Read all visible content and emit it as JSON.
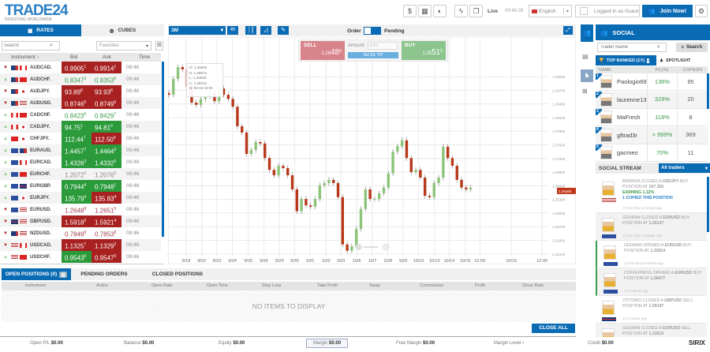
{
  "header": {
    "logo": "TRADE24",
    "logo_sub": "INVESTING WORLDWIDE",
    "live": "Live",
    "clock": "09:46:38",
    "language": "English",
    "login_status": "Logged in as Guest",
    "join_label": "Join Now!"
  },
  "rates": {
    "tabs": [
      "RATES",
      "CUBES"
    ],
    "search_placeholder": "Search",
    "filter": "Favorites",
    "columns": [
      "Instrument ↑",
      "Bid",
      "Ask",
      "Time"
    ],
    "rows": [
      {
        "name": "AUDCAD.",
        "dir": "down",
        "bid": "0.9905",
        "bid_sup": "1",
        "bid_state": "red",
        "ask": "0.9914",
        "ask_sup": "1",
        "ask_state": "red",
        "time": "09:46"
      },
      {
        "name": "AUDCHF.",
        "dir": "up",
        "bid": "0.8347",
        "bid_sup": "3",
        "bid_state": "up",
        "ask": "0.8353",
        "ask_sup": "6",
        "ask_state": "up",
        "time": "09:46"
      },
      {
        "name": "AUDJPY.",
        "dir": "down",
        "bid": "93.89",
        "bid_sup": "8",
        "bid_state": "red",
        "ask": "93.93",
        "ask_sup": "8",
        "ask_state": "red",
        "time": "09:46"
      },
      {
        "name": "AUDUSD.",
        "dir": "down",
        "bid": "0.8746",
        "bid_sup": "0",
        "bid_state": "red",
        "ask": "0.8749",
        "ask_sup": "6",
        "ask_state": "red",
        "time": "09:46"
      },
      {
        "name": "CADCHF.",
        "dir": "up",
        "bid": "0.8423",
        "bid_sup": "6",
        "bid_state": "up",
        "ask": "0.8429",
        "ask_sup": "7",
        "ask_state": "up",
        "time": "09:46"
      },
      {
        "name": "CADJPY.",
        "dir": "up",
        "bid": "94.75",
        "bid_sup": "1",
        "bid_state": "green",
        "ask": "94.81",
        "ask_sup": "0",
        "ask_state": "green",
        "time": "09:46"
      },
      {
        "name": "CHFJPY.",
        "dir": "up",
        "bid": "112.44",
        "bid_sup": "7",
        "bid_state": "green",
        "ask": "112.50",
        "ask_sup": "9",
        "ask_state": "red",
        "time": "09:46"
      },
      {
        "name": "EURAUD.",
        "dir": "up",
        "bid": "1.4457",
        "bid_sup": "7",
        "bid_state": "green",
        "ask": "1.4464",
        "ask_sup": "3",
        "ask_state": "green",
        "time": "09:46"
      },
      {
        "name": "EURCAD.",
        "dir": "up",
        "bid": "1.4326",
        "bid_sup": "3",
        "bid_state": "green",
        "ask": "1.4332",
        "ask_sup": "5",
        "ask_state": "green",
        "time": "09:46"
      },
      {
        "name": "EURCHF.",
        "dir": "up",
        "bid": "1.2072",
        "bid_sup": "6",
        "bid_state": "none",
        "ask": "1.2076",
        "ask_sup": "9",
        "ask_state": "none",
        "time": "09:46"
      },
      {
        "name": "EURGBP.",
        "dir": "up",
        "bid": "0.7944",
        "bid_sup": "4",
        "bid_state": "green",
        "ask": "0.7948",
        "ask_sup": "1",
        "ask_state": "green",
        "time": "09:46"
      },
      {
        "name": "EURJPY.",
        "dir": "up",
        "bid": "135.79",
        "bid_sup": "4",
        "bid_state": "green",
        "ask": "135.83",
        "ask_sup": "4",
        "ask_state": "red",
        "time": "09:46"
      },
      {
        "name": "EURUSD.",
        "dir": "down",
        "bid": "1.2648",
        "bid_sup": "8",
        "bid_state": "down",
        "ask": "1.2651",
        "ask_sup": "5",
        "ask_state": "down",
        "time": "09:46"
      },
      {
        "name": "GBPUSD.",
        "dir": "down",
        "bid": "1.5918",
        "bid_sup": "0",
        "bid_state": "red",
        "ask": "1.5921",
        "ask_sup": "4",
        "ask_state": "red",
        "time": "09:46"
      },
      {
        "name": "NZDUSD.",
        "dir": "down",
        "bid": "0.7849",
        "bid_sup": "8",
        "bid_state": "down",
        "ask": "0.7853",
        "ask_sup": "8",
        "ask_state": "down",
        "time": "09:46"
      },
      {
        "name": "USDCAD.",
        "dir": "down",
        "bid": "1.1325",
        "bid_sup": "7",
        "bid_state": "red",
        "ask": "1.1329",
        "ask_sup": "2",
        "ask_state": "red",
        "time": "09:46"
      },
      {
        "name": "USDCHF.",
        "dir": "up",
        "bid": "0.9543",
        "bid_sup": "5",
        "bid_state": "green",
        "ask": "0.9547",
        "ask_sup": "0",
        "ask_state": "red",
        "time": "09:46"
      }
    ]
  },
  "chart_toolbar": {
    "period": "3M",
    "interval": "4h",
    "order_label": "Order",
    "pending_label": "Pending"
  },
  "trade_box": {
    "sell_label": "SELL",
    "sell_price": "1.26",
    "sell_big": "48",
    "sell_sup": "6",
    "amount_label": "Amount",
    "amount_value": "0.01",
    "sl_tp_label": "Set S/L T/P",
    "buy_label": "BUY",
    "buy_price": "1.26",
    "buy_big": "51",
    "buy_sup": "6"
  },
  "tooltip": {
    "o_label": "O:",
    "o": "1.28836",
    "h_label": "H:",
    "h": "1.28873",
    "l_label": "L:",
    "l": "1.28828",
    "c_label": "C:",
    "c": "1.28215",
    "d_label": "D:",
    "d": "09-18 16:00"
  },
  "colors": {
    "brand": "#0a6bb5",
    "up": "#2a9a3a",
    "down": "#a82020",
    "candle_up": "#8cc47a",
    "candle_down": "#b8381a"
  },
  "chart_data": {
    "type": "candlestick",
    "current_price": "1.26486",
    "ylim": [
      1.2487,
      1.2987
    ],
    "xlim": [
      -0.17,
      89.0
    ],
    "yticks": [
      "1.29000",
      "1.28700",
      "1.28400",
      "1.28100",
      "1.27800",
      "1.27500",
      "1.27200",
      "1.26900",
      "1.26600",
      "1.26300",
      "1.26000",
      "1.25700",
      "1.25400",
      "1.25100"
    ],
    "xticks": [
      {
        "label": "9/19",
        "i": 3.8
      },
      {
        "label": "9/22",
        "i": 7.2
      },
      {
        "label": "9/23",
        "i": 10.5
      },
      {
        "label": "9/24",
        "i": 13.9
      },
      {
        "label": "9/25",
        "i": 17.4
      },
      {
        "label": "9/26",
        "i": 20.8
      },
      {
        "label": "9/29",
        "i": 24.2
      },
      {
        "label": "9/30",
        "i": 27.5
      },
      {
        "label": "10/1",
        "i": 30.9
      },
      {
        "label": "10/2",
        "i": 34.4
      },
      {
        "label": "10/3",
        "i": 37.6
      },
      {
        "label": "10/6",
        "i": 41.1
      },
      {
        "label": "10/7",
        "i": 44.5
      },
      {
        "label": "10/8",
        "i": 47.9
      },
      {
        "label": "10/9",
        "i": 51.2
      },
      {
        "label": "10/10",
        "i": 54.6
      },
      {
        "label": "10/13",
        "i": 58.1
      },
      {
        "label": "10/14",
        "i": 61.3
      },
      {
        "label": "10/15",
        "i": 64.8
      },
      {
        "label": "12:00",
        "i": 68.0
      },
      {
        "label": "10/16",
        "i": 74.9
      },
      {
        "label": "12:00",
        "i": 81.6
      }
    ],
    "close": [
      1.286,
      1.2895,
      1.2921,
      1.2916,
      1.2878,
      1.2843,
      1.2838,
      1.2851,
      1.2857,
      1.2864,
      1.2846,
      1.2874,
      1.286,
      1.2851,
      1.2834,
      1.2791,
      1.2777,
      1.273,
      1.2739,
      1.2756,
      1.2753,
      1.2721,
      1.2695,
      1.2683,
      1.2704,
      1.2699,
      1.2683,
      1.2652,
      1.2604,
      1.2631,
      1.2617,
      1.2614,
      1.2631,
      1.2661,
      1.2666,
      1.2673,
      1.2666,
      1.2635,
      1.2531,
      1.2517,
      1.2527,
      1.2565,
      1.2609,
      1.2652,
      1.2631,
      1.2631,
      1.2643,
      1.2656,
      1.2687,
      1.2735,
      1.2747,
      1.276,
      1.2721,
      1.269,
      1.2695,
      1.2678,
      1.2638,
      1.2635,
      1.2666,
      1.2678,
      1.2746,
      1.2721,
      1.2704,
      1.2673,
      1.2656,
      1.2652,
      1.2656
    ]
  },
  "social": {
    "title": "SOCIAL",
    "search_placeholder": "Trader Name",
    "search_label": "Search",
    "tabs": [
      "TOP RANKED (1Y)",
      "SPOTLIGHT"
    ],
    "columns": [
      "NAME",
      "P/L(%)",
      "COPIERS"
    ],
    "traders": [
      {
        "rank": "1",
        "name": "Paologio69",
        "pl": "136%",
        "copiers": "95"
      },
      {
        "rank": "2",
        "name": "laurenne13",
        "pl": "329%",
        "copiers": "20"
      },
      {
        "rank": "3",
        "name": "MaFresh",
        "pl": "118%",
        "copiers": "8"
      },
      {
        "rank": "4",
        "name": "gftrad3r",
        "pl": "> 999%",
        "copiers": "369"
      },
      {
        "rank": "5",
        "name": "gacmeo",
        "pl": "70%",
        "copiers": "11"
      }
    ],
    "stream_title": "SOCIAL STREAM",
    "stream_filter": "All traders",
    "stream": [
      {
        "who": "BRIANZA",
        "action": "CLOSED A",
        "sym": "USDJPY",
        "side": "BUY",
        "at": "POSITION AT",
        "price": "107.350",
        "extra1": "EARNING 1.12%",
        "extra2": "1 COPIED THIS POSITION",
        "ago": "less than a minute ago"
      },
      {
        "who": "GDURAN",
        "action": "CLOSED A",
        "sym": "EURUSD",
        "side": "BUY",
        "at": "POSITION AT",
        "price": "1.20137",
        "ago": "less than a minute ago"
      },
      {
        "who": "GDURAN",
        "action": "OPENED A",
        "sym": "EURUSD",
        "side": "BUY",
        "at": "POSITION AT",
        "price": "1.32814",
        "ago": "less than a minute ago"
      },
      {
        "who": "COFFEPRESS",
        "action": "OPENED A",
        "sym": "EURUSD",
        "side": "BUY",
        "at": "POSITION AT",
        "price": "1.26477",
        "ago": "1 minute ago"
      },
      {
        "who": "VITTORIO",
        "action": "CLOSED A",
        "sym": "GBPUSD",
        "side": "SELL",
        "at": "POSITION AT",
        "price": "1.59197",
        "ago": "1 minute ago"
      },
      {
        "who": "GDURAN",
        "action": "CLOSED A",
        "sym": "EURUSD",
        "side": "SELL",
        "at": "POSITION AT",
        "price": "1.32813",
        "ago": ""
      }
    ]
  },
  "positions": {
    "tabs": [
      "OPEN POSITIONS (0)",
      "PENDING ORDERS",
      "CLOSED POSITIONS"
    ],
    "columns": [
      "Instrument",
      "Action",
      "Open Rate",
      "Open Time",
      "Stop Loss",
      "Take Profit",
      "Swap",
      "Commission",
      "Profit",
      "Close Rate"
    ],
    "empty": "NO ITEMS TO DISPLAY",
    "close_all": "CLOSE ALL"
  },
  "footer": [
    {
      "label": "Open P/L",
      "value": "$0.00"
    },
    {
      "label": "Balance",
      "value": "$0.00"
    },
    {
      "label": "Equity",
      "value": "$0.00"
    },
    {
      "label": "Margin",
      "value": "$0.00"
    },
    {
      "label": "Free Margin",
      "value": "$0.00"
    },
    {
      "label": "Margin Level",
      "value": "-"
    },
    {
      "label": "Credit",
      "value": "$0.00"
    }
  ],
  "brand_footer": "SIRIX"
}
